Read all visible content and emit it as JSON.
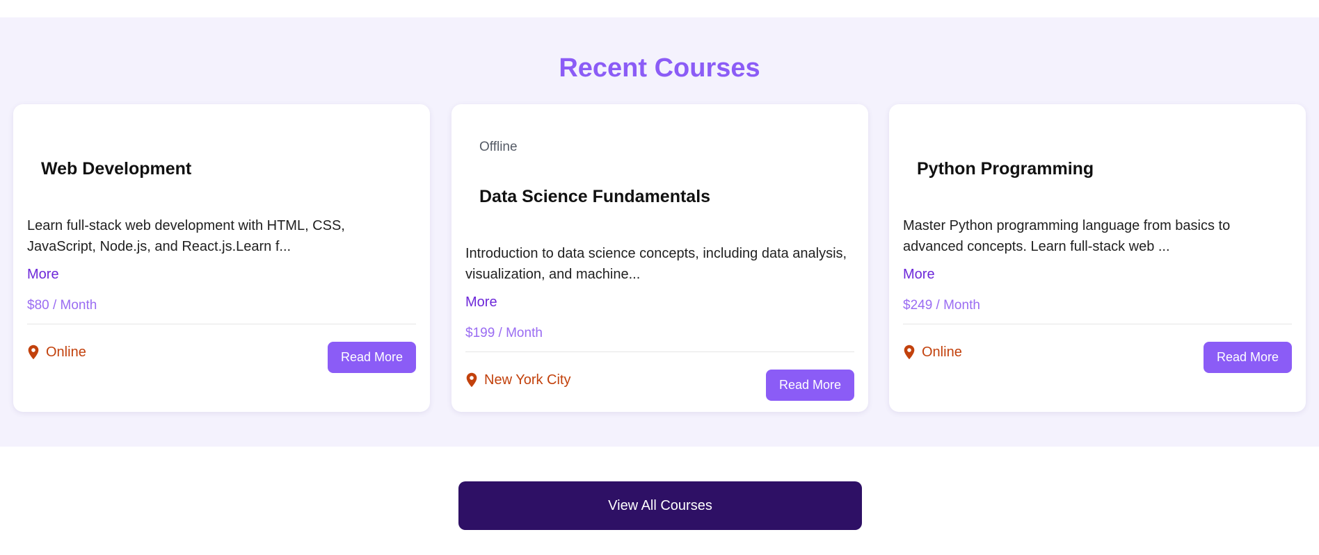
{
  "section": {
    "title": "Recent Courses"
  },
  "courses": [
    {
      "mode": "",
      "title": "Web Development",
      "description_line1": "Learn full-stack web development with HTML, CSS,",
      "description_line2": "JavaScript, Node.js, and React.js.Learn f...",
      "more_label": "More",
      "price": "$80 / Month",
      "location": "Online",
      "location_icon": "map-pin-icon",
      "button_label": "Read More"
    },
    {
      "mode": "Offline",
      "title": "Data Science Fundamentals",
      "description_line1": "Introduction to data science concepts, including data analysis,",
      "description_line2": "visualization, and machine...",
      "more_label": "More",
      "price": "$199 / Month",
      "location": "New York City",
      "location_icon": "map-pin-icon",
      "button_label": "Read More"
    },
    {
      "mode": "",
      "title": "Python Programming",
      "description_line1": "Master Python programming language from basics to",
      "description_line2": "advanced concepts. Learn full-stack web ...",
      "more_label": "More",
      "price": "$249 / Month",
      "location": "Online",
      "location_icon": "map-pin-icon",
      "button_label": "Read More"
    }
  ],
  "footer": {
    "view_all_label": "View All Courses"
  },
  "colors": {
    "accent": "#8b5cf6",
    "dark_button": "#2e1065",
    "location": "#c2410c",
    "section_bg": "#f4f2fd"
  }
}
